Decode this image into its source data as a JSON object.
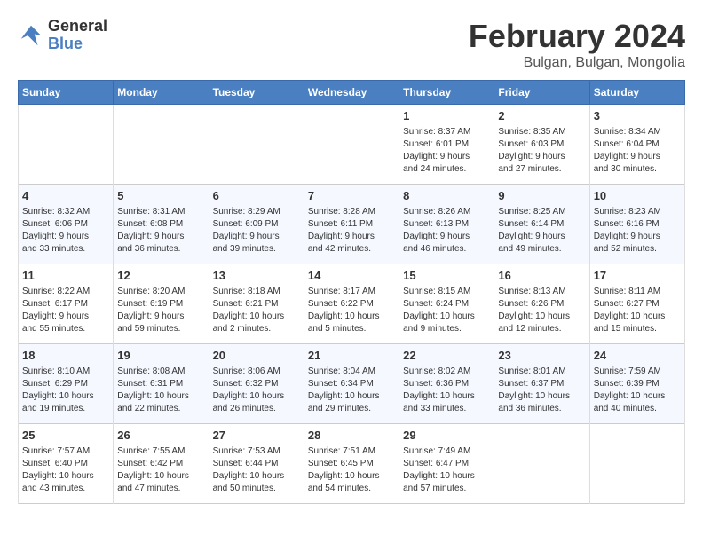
{
  "logo": {
    "line1": "General",
    "line2": "Blue"
  },
  "title": "February 2024",
  "subtitle": "Bulgan, Bulgan, Mongolia",
  "headers": [
    "Sunday",
    "Monday",
    "Tuesday",
    "Wednesday",
    "Thursday",
    "Friday",
    "Saturday"
  ],
  "weeks": [
    [
      {
        "day": "",
        "info": ""
      },
      {
        "day": "",
        "info": ""
      },
      {
        "day": "",
        "info": ""
      },
      {
        "day": "",
        "info": ""
      },
      {
        "day": "1",
        "info": "Sunrise: 8:37 AM\nSunset: 6:01 PM\nDaylight: 9 hours\nand 24 minutes."
      },
      {
        "day": "2",
        "info": "Sunrise: 8:35 AM\nSunset: 6:03 PM\nDaylight: 9 hours\nand 27 minutes."
      },
      {
        "day": "3",
        "info": "Sunrise: 8:34 AM\nSunset: 6:04 PM\nDaylight: 9 hours\nand 30 minutes."
      }
    ],
    [
      {
        "day": "4",
        "info": "Sunrise: 8:32 AM\nSunset: 6:06 PM\nDaylight: 9 hours\nand 33 minutes."
      },
      {
        "day": "5",
        "info": "Sunrise: 8:31 AM\nSunset: 6:08 PM\nDaylight: 9 hours\nand 36 minutes."
      },
      {
        "day": "6",
        "info": "Sunrise: 8:29 AM\nSunset: 6:09 PM\nDaylight: 9 hours\nand 39 minutes."
      },
      {
        "day": "7",
        "info": "Sunrise: 8:28 AM\nSunset: 6:11 PM\nDaylight: 9 hours\nand 42 minutes."
      },
      {
        "day": "8",
        "info": "Sunrise: 8:26 AM\nSunset: 6:13 PM\nDaylight: 9 hours\nand 46 minutes."
      },
      {
        "day": "9",
        "info": "Sunrise: 8:25 AM\nSunset: 6:14 PM\nDaylight: 9 hours\nand 49 minutes."
      },
      {
        "day": "10",
        "info": "Sunrise: 8:23 AM\nSunset: 6:16 PM\nDaylight: 9 hours\nand 52 minutes."
      }
    ],
    [
      {
        "day": "11",
        "info": "Sunrise: 8:22 AM\nSunset: 6:17 PM\nDaylight: 9 hours\nand 55 minutes."
      },
      {
        "day": "12",
        "info": "Sunrise: 8:20 AM\nSunset: 6:19 PM\nDaylight: 9 hours\nand 59 minutes."
      },
      {
        "day": "13",
        "info": "Sunrise: 8:18 AM\nSunset: 6:21 PM\nDaylight: 10 hours\nand 2 minutes."
      },
      {
        "day": "14",
        "info": "Sunrise: 8:17 AM\nSunset: 6:22 PM\nDaylight: 10 hours\nand 5 minutes."
      },
      {
        "day": "15",
        "info": "Sunrise: 8:15 AM\nSunset: 6:24 PM\nDaylight: 10 hours\nand 9 minutes."
      },
      {
        "day": "16",
        "info": "Sunrise: 8:13 AM\nSunset: 6:26 PM\nDaylight: 10 hours\nand 12 minutes."
      },
      {
        "day": "17",
        "info": "Sunrise: 8:11 AM\nSunset: 6:27 PM\nDaylight: 10 hours\nand 15 minutes."
      }
    ],
    [
      {
        "day": "18",
        "info": "Sunrise: 8:10 AM\nSunset: 6:29 PM\nDaylight: 10 hours\nand 19 minutes."
      },
      {
        "day": "19",
        "info": "Sunrise: 8:08 AM\nSunset: 6:31 PM\nDaylight: 10 hours\nand 22 minutes."
      },
      {
        "day": "20",
        "info": "Sunrise: 8:06 AM\nSunset: 6:32 PM\nDaylight: 10 hours\nand 26 minutes."
      },
      {
        "day": "21",
        "info": "Sunrise: 8:04 AM\nSunset: 6:34 PM\nDaylight: 10 hours\nand 29 minutes."
      },
      {
        "day": "22",
        "info": "Sunrise: 8:02 AM\nSunset: 6:36 PM\nDaylight: 10 hours\nand 33 minutes."
      },
      {
        "day": "23",
        "info": "Sunrise: 8:01 AM\nSunset: 6:37 PM\nDaylight: 10 hours\nand 36 minutes."
      },
      {
        "day": "24",
        "info": "Sunrise: 7:59 AM\nSunset: 6:39 PM\nDaylight: 10 hours\nand 40 minutes."
      }
    ],
    [
      {
        "day": "25",
        "info": "Sunrise: 7:57 AM\nSunset: 6:40 PM\nDaylight: 10 hours\nand 43 minutes."
      },
      {
        "day": "26",
        "info": "Sunrise: 7:55 AM\nSunset: 6:42 PM\nDaylight: 10 hours\nand 47 minutes."
      },
      {
        "day": "27",
        "info": "Sunrise: 7:53 AM\nSunset: 6:44 PM\nDaylight: 10 hours\nand 50 minutes."
      },
      {
        "day": "28",
        "info": "Sunrise: 7:51 AM\nSunset: 6:45 PM\nDaylight: 10 hours\nand 54 minutes."
      },
      {
        "day": "29",
        "info": "Sunrise: 7:49 AM\nSunset: 6:47 PM\nDaylight: 10 hours\nand 57 minutes."
      },
      {
        "day": "",
        "info": ""
      },
      {
        "day": "",
        "info": ""
      }
    ]
  ]
}
